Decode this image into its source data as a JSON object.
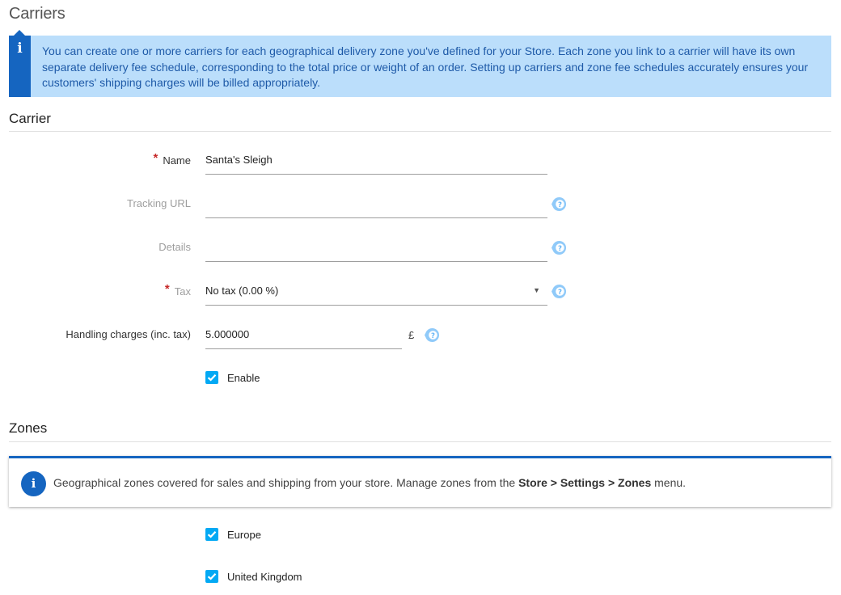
{
  "page": {
    "title": "Carriers"
  },
  "info_banner": {
    "icon": "info-icon",
    "text": "You can create one or more carriers for each geographical delivery zone you've defined for your Store. Each zone you link to a carrier will have its own separate delivery fee schedule, corresponding to the total price or weight of an order. Setting up carriers and zone fee schedules accurately ensures your customers' shipping charges will be billed appropriately."
  },
  "carrier_section": {
    "title": "Carrier",
    "required_marker": "*",
    "fields": {
      "name": {
        "label": "Name",
        "value": "Santa's Sleigh",
        "required": true
      },
      "tracking_url": {
        "label": "Tracking URL",
        "value": "",
        "help_icon": "help-icon"
      },
      "details": {
        "label": "Details",
        "value": "",
        "help_icon": "help-icon"
      },
      "tax": {
        "label": "Tax",
        "value": "No tax (0.00 %)",
        "required": true,
        "caret": "▼",
        "help_icon": "help-icon"
      },
      "handling_charges": {
        "label": "Handling charges (inc. tax)",
        "value": "5.000000",
        "currency": "£",
        "help_icon": "help-icon"
      },
      "enable": {
        "label": "Enable",
        "checked": true
      }
    }
  },
  "zones_section": {
    "title": "Zones",
    "notice": {
      "icon": "info-icon",
      "text_prefix": "Geographical zones covered for sales and shipping from your store. Manage zones from the ",
      "text_bold": "Store > Settings > Zones",
      "text_suffix": " menu."
    },
    "zones": [
      {
        "label": "Europe",
        "checked": true
      },
      {
        "label": "United Kingdom",
        "checked": true
      }
    ]
  },
  "colors": {
    "accent": "#1565c0",
    "banner_bg": "#bbdefb",
    "checkbox": "#03a9f4",
    "help_icon": "#90caf9",
    "required": "#c62828"
  }
}
